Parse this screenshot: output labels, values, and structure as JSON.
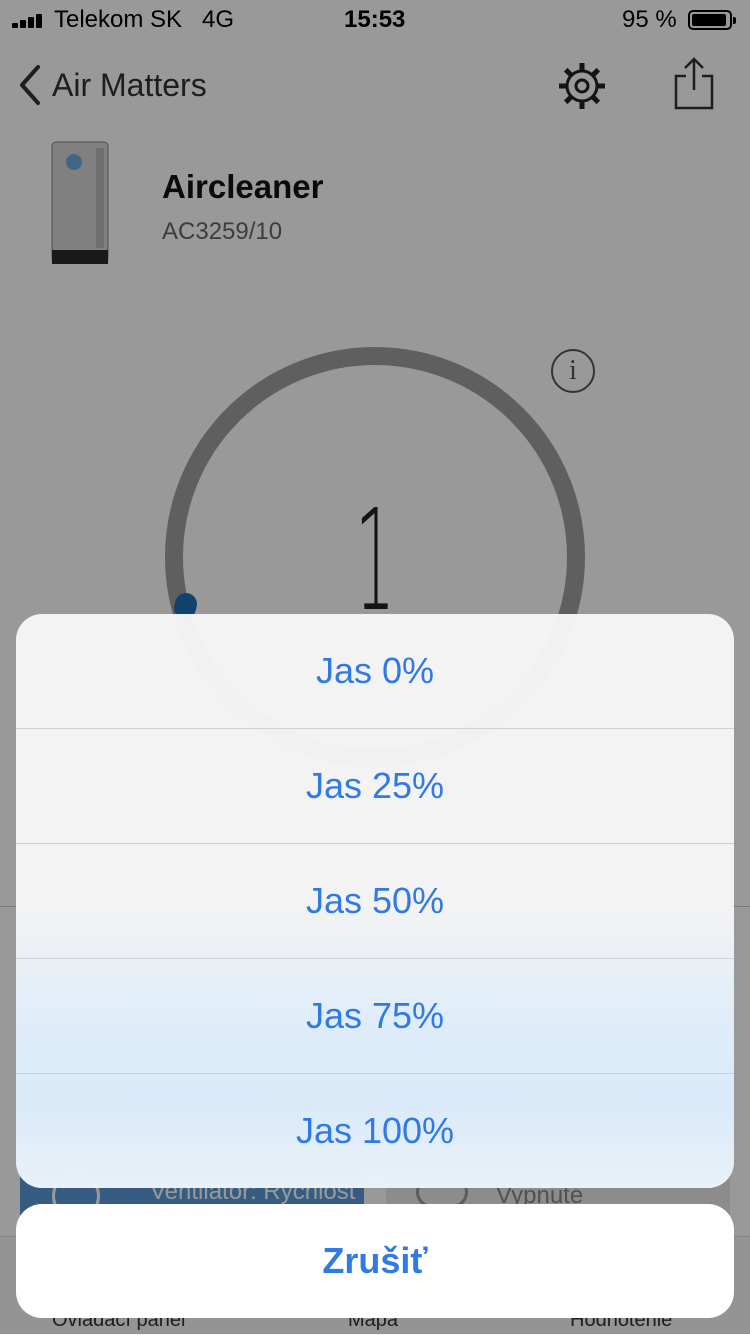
{
  "status_bar": {
    "carrier": "Telekom SK",
    "network": "4G",
    "time": "15:53",
    "battery": "95 %"
  },
  "nav": {
    "back_label": "Air Matters",
    "icons": [
      "chevron-left-icon",
      "gear-icon",
      "share-icon"
    ]
  },
  "device": {
    "name": "Aircleaner",
    "model": "AC3259/10"
  },
  "gauge": {
    "value": "1",
    "icon": "info-icon"
  },
  "tiles": {
    "left_label": "Ventilátor: Rýchlosť 1",
    "right_label": "Vypnuté"
  },
  "tabs": [
    "Ovládací panel",
    "Mapa",
    "Hodnotenie"
  ],
  "action_sheet": {
    "options": [
      "Jas 0%",
      "Jas 25%",
      "Jas 50%",
      "Jas 75%",
      "Jas 100%"
    ],
    "cancel": "Zrušiť"
  },
  "colors": {
    "accent": "#2f7ae5",
    "dim_overlay": "rgba(0,0,0,0.40)",
    "ring": "#9e9e9e",
    "ring_indicator": "#1e6fb4"
  }
}
